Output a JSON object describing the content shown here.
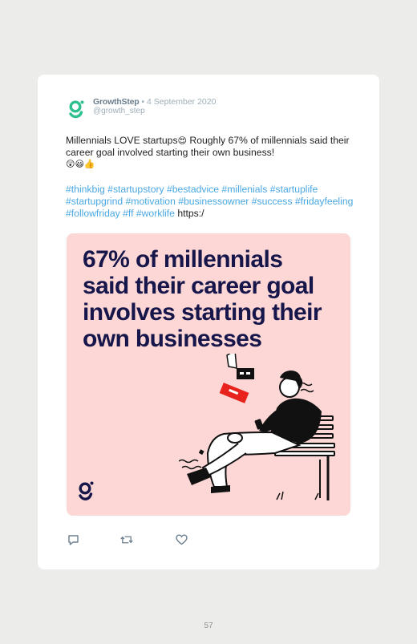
{
  "tweet": {
    "author_name": "GrowthStep",
    "separator": "•",
    "date": "4 September 2020",
    "handle": "@growth_step",
    "text_part1": "Millennials LOVE startups",
    "emoji_1": "😍",
    "text_part2": " Roughly 67% of millennials said their career goal involved starting their own business!",
    "emoji_2": "😲😃👍",
    "hashtags": "#thinkbig #startupstory #bestadvice #millenials #startuplife #startupgrind #motivation #businessowner #success #fridayfeeling #followfriday #ff #worklife",
    "link_text": "https:/"
  },
  "media": {
    "headline": "67% of millennials said their career goal involves starting their own businesses",
    "background": "#fcd7d6",
    "headline_color": "#16164a"
  },
  "brand": {
    "logo_color": "#2ec090",
    "media_logo_color": "#16164a"
  },
  "actions": [
    {
      "icon": "reply-icon"
    },
    {
      "icon": "retweet-icon"
    },
    {
      "icon": "like-icon"
    }
  ],
  "page": {
    "number": "57"
  },
  "colors": {
    "hashtag": "#4aa8e2",
    "meta": "#9eaeb8",
    "author": "#6b7e8e",
    "accent_red": "#e8231d"
  }
}
